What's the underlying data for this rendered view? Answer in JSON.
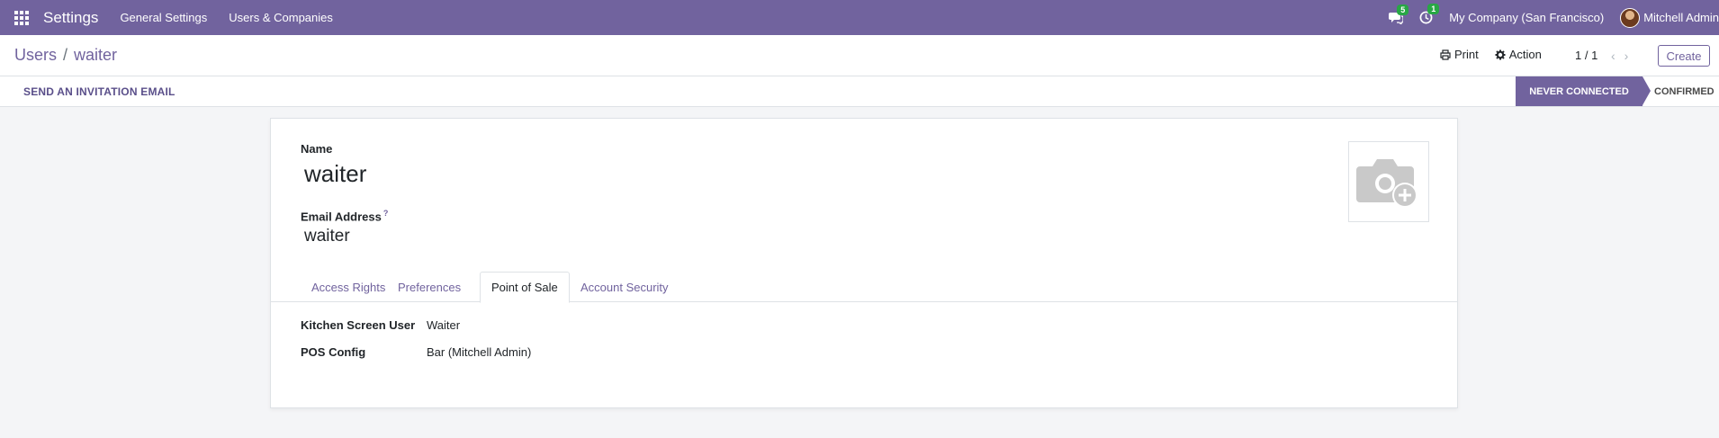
{
  "navbar": {
    "app_name": "Settings",
    "menus": [
      "General Settings",
      "Users & Companies"
    ],
    "messages_count": "5",
    "activities_count": "1",
    "company": "My Company (San Francisco)",
    "user": "Mitchell Admin",
    "bg_color": "#71639e"
  },
  "breadcrumb": {
    "parent": "Users",
    "separator": "/",
    "current": "waiter"
  },
  "control_panel": {
    "print_label": "Print",
    "action_label": "Action",
    "pager": "1 / 1",
    "create_label": "Create"
  },
  "statusbar": {
    "invite_label": "SEND AN INVITATION EMAIL",
    "stages": [
      "NEVER CONNECTED",
      "CONFIRMED"
    ],
    "active_stage": "NEVER CONNECTED"
  },
  "form": {
    "name_label": "Name",
    "name_value": "waiter",
    "email_label": "Email Address",
    "email_help": "?",
    "email_value": "waiter",
    "tabs": [
      "Access Rights",
      "Preferences",
      "Point of Sale",
      "Account Security"
    ],
    "active_tab": "Point of Sale",
    "fields": [
      {
        "label": "Kitchen Screen User",
        "value": "Waiter"
      },
      {
        "label": "POS Config",
        "value": "Bar (Mitchell Admin)"
      }
    ]
  },
  "icons": [
    "apps-grid-icon",
    "chat-icon",
    "clock-icon",
    "print-icon",
    "gear-icon",
    "chevron-left-icon",
    "chevron-right-icon",
    "camera-plus-icon"
  ]
}
